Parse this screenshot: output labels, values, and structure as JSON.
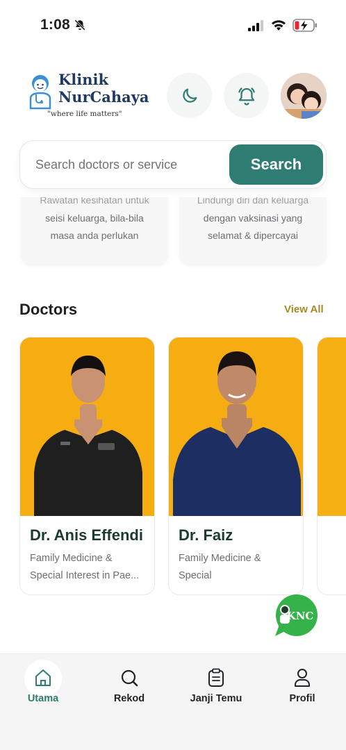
{
  "status_bar": {
    "time": "1:08",
    "icons": [
      "bell-slash-icon",
      "signal-icon",
      "wifi-icon",
      "battery-charging-icon"
    ]
  },
  "brand": {
    "name_line1": "Klinik",
    "name_line2": "NurCahaya",
    "tagline": "\"where life matters\""
  },
  "header_buttons": {
    "theme_icon": "moon-icon",
    "notification_icon": "bell-icon"
  },
  "search": {
    "placeholder": "Search doctors or service",
    "button_label": "Search"
  },
  "services": [
    {
      "lines": [
        "Rawatan kesihatan untuk",
        "seisi keluarga, bila-bila",
        "masa anda perlukan"
      ]
    },
    {
      "lines": [
        "Lindungi diri dan keluarga",
        "dengan vaksinasi yang",
        "selamat & dipercayai"
      ]
    }
  ],
  "doctors_section": {
    "title": "Doctors",
    "view_all": "View All",
    "doctors": [
      {
        "name": "Dr. Anis Effendi",
        "specialty_line1": "Family Medicine &",
        "specialty_line2": "Special Interest in Pae..."
      },
      {
        "name": "Dr. Faiz",
        "specialty_line1": "Family Medicine &",
        "specialty_line2": "Special"
      }
    ]
  },
  "chat_fab": {
    "label": "KNC"
  },
  "bottom_nav": {
    "items": [
      {
        "label": "Utama",
        "icon": "home-icon",
        "active": true
      },
      {
        "label": "Rekod",
        "icon": "search-record-icon",
        "active": false
      },
      {
        "label": "Janji Temu",
        "icon": "clipboard-icon",
        "active": false
      },
      {
        "label": "Profil",
        "icon": "user-icon",
        "active": false
      }
    ]
  },
  "colors": {
    "primary": "#2f7d72",
    "accent_gold": "#a58a24",
    "doctor_photo_bg": "#f7b013",
    "doctor_name": "#1c3a33"
  }
}
